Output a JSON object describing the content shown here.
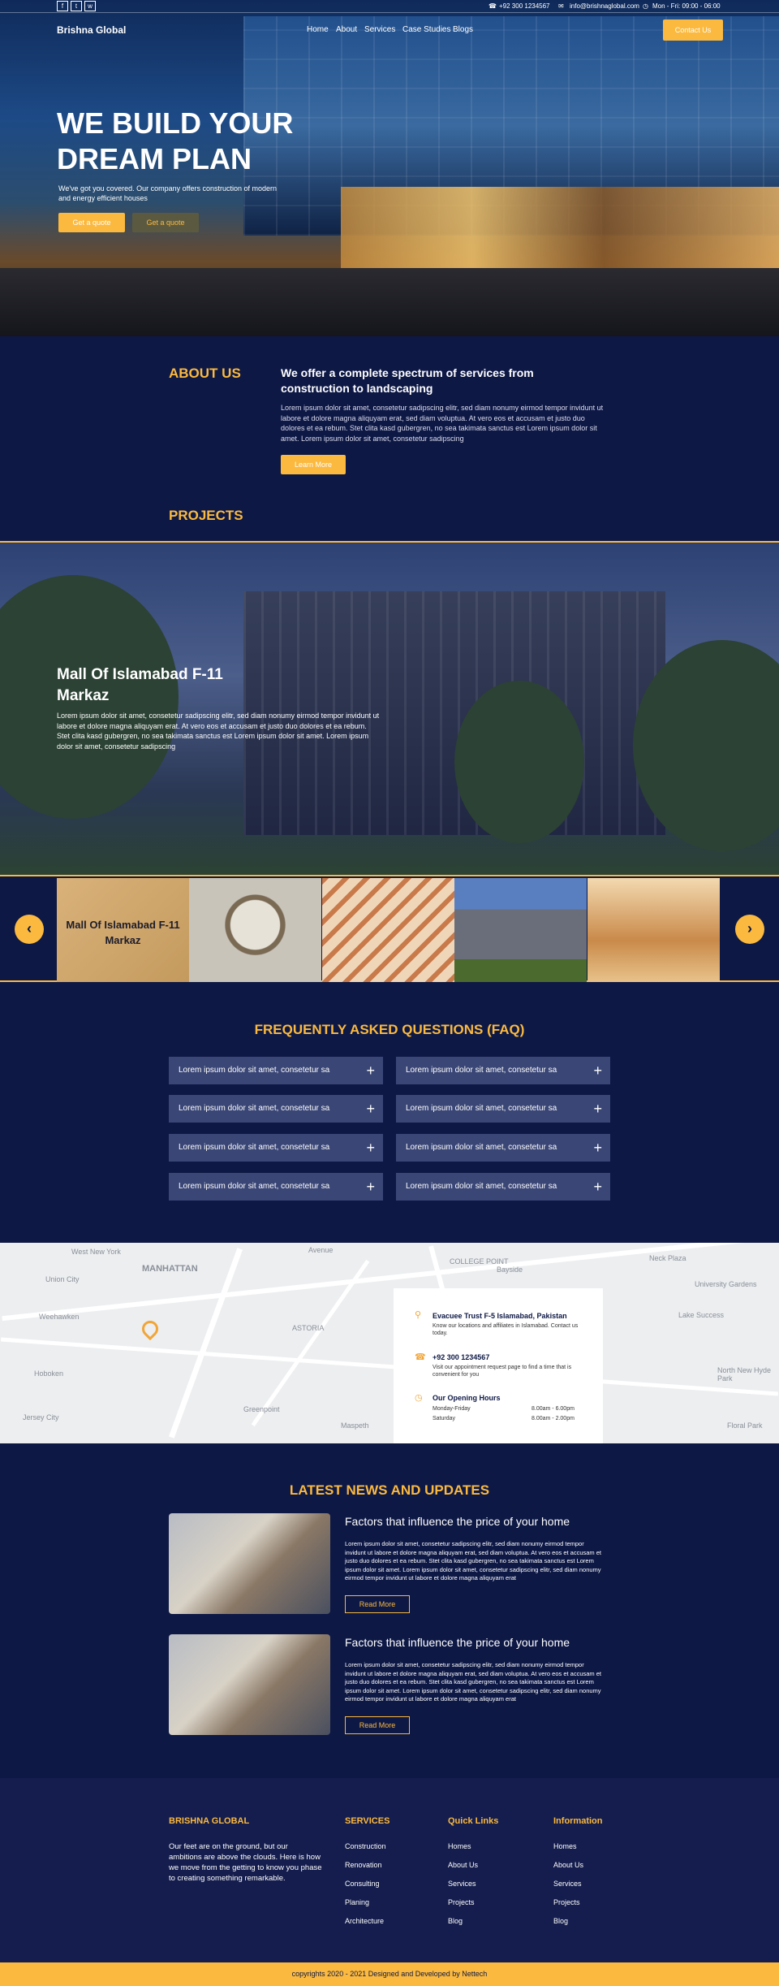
{
  "topbar": {
    "social": [
      "f",
      "t",
      "w"
    ],
    "phone": "+92 300 1234567",
    "email": "info@brishnaglobal.com",
    "hours": "Mon - Fri: 09:00 - 06:00"
  },
  "header": {
    "logo": "Brishna Global",
    "nav": [
      "Home",
      "About",
      "Services",
      "Case Studies",
      "Blogs"
    ],
    "contact_button": "Contact Us"
  },
  "hero": {
    "title": "WE BUILD YOUR DREAM PLAN",
    "subtitle": "We've got you covered. Our company offers construction of modern and energy efficient houses",
    "button_primary": "Get a quote",
    "button_secondary": "Get a quote"
  },
  "about": {
    "title": "ABOUT US",
    "heading": "We offer a complete spectrum of services from construction to landscaping",
    "text": "Lorem ipsum dolor sit amet, consetetur sadipscing elitr, sed diam nonumy eirmod tempor invidunt ut labore et dolore magna aliquyam erat, sed diam voluptua. At vero eos et accusam et justo duo dolores et ea rebum. Stet clita kasd gubergren, no sea takimata sanctus est Lorem ipsum dolor sit amet. Lorem ipsum dolor sit amet, consetetur sadipscing",
    "button": "Learn More"
  },
  "projects": {
    "title": "PROJECTS",
    "featured_title": "Mall Of Islamabad F-11 Markaz",
    "featured_text": "Lorem ipsum dolor sit amet, consetetur sadipscing elitr, sed diam nonumy eirmod tempor invidunt ut labore et dolore magna aliquyam erat. At vero eos et accusam et justo duo dolores et ea rebum. Stet clita kasd gubergren, no sea takimata sanctus est Lorem ipsum dolor sit amet. Lorem ipsum dolor sit amet, consetetur sadipscing",
    "thumb_label": "Mall Of Islamabad F-11 Markaz"
  },
  "faq": {
    "title": "FREQUENTLY ASKED QUESTIONS (FAQ)",
    "items": [
      "Lorem ipsum dolor sit amet, consetetur sa",
      "Lorem ipsum dolor sit amet, consetetur sa",
      "Lorem ipsum dolor sit amet, consetetur sa",
      "Lorem ipsum dolor sit amet, consetetur sa",
      "Lorem ipsum dolor sit amet, consetetur sa",
      "Lorem ipsum dolor sit amet, consetetur sa",
      "Lorem ipsum dolor sit amet, consetetur sa",
      "Lorem ipsum dolor sit amet, consetetur sa"
    ]
  },
  "map": {
    "labels": [
      "West New York",
      "MANHATTAN",
      "Union City",
      "Weehawken",
      "Hoboken",
      "Jersey City",
      "ASTORIA",
      "Maspeth",
      "Greenpoint",
      "Avenue",
      "Neck Plaza",
      "University Gardens",
      "Lake Success",
      "North New Hyde Park",
      "Floral Park",
      "Bayside",
      "COLLEGE POINT"
    ],
    "address_title": "Evacuee Trust F-5 Islamabad, Pakistan",
    "address_text": "Know our locations and affiliates in Islamabad. Contact us today.",
    "phone": "+92 300 1234567",
    "phone_text": "Visit our appointment request page to find a time that is convenient for you",
    "hours_title": "Our Opening Hours",
    "hours": [
      {
        "day": "Monday-Friday",
        "time": "8.00am - 6.00pm"
      },
      {
        "day": "Saturday",
        "time": "8.00am - 2.00pm"
      }
    ]
  },
  "news": {
    "title": "LATEST NEWS AND UPDATES",
    "items": [
      {
        "heading": "Factors that influence the price of your home",
        "text": "Lorem ipsum dolor sit amet, consetetur sadipscing elitr, sed diam nonumy eirmod tempor invidunt ut labore et dolore magna aliquyam erat, sed diam voluptua. At vero eos et accusam et justo duo dolores et ea rebum. Stet clita kasd gubergren, no sea takimata sanctus est Lorem ipsum dolor sit amet. Lorem ipsum dolor sit amet, consetetur sadipscing elitr, sed diam nonumy eirmod tempor invidunt ut labore et dolore magna aliquyam erat",
        "button": "Read More"
      },
      {
        "heading": "Factors that influence the price of your home",
        "text": "Lorem ipsum dolor sit amet, consetetur sadipscing elitr, sed diam nonumy eirmod tempor invidunt ut labore et dolore magna aliquyam erat, sed diam voluptua. At vero eos et accusam et justo duo dolores et ea rebum. Stet clita kasd gubergren, no sea takimata sanctus est Lorem ipsum dolor sit amet. Lorem ipsum dolor sit amet, consetetur sadipscing elitr, sed diam nonumy eirmod tempor invidunt ut labore et dolore magna aliquyam erat",
        "button": "Read More"
      }
    ]
  },
  "footer": {
    "brand": "BRISHNA GLOBAL",
    "description": "Our feet are on the ground, but our ambitions are above the clouds. Here is how we move from the getting to know you phase to creating something remarkable.",
    "services_title": "SERVICES",
    "services": [
      "Construction",
      "Renovation",
      "Consulting",
      "Planing",
      "Architecture"
    ],
    "quick_title": "Quick Links",
    "quick": [
      "Homes",
      "About Us",
      "Services",
      "Projects",
      "Blog"
    ],
    "info_title": "Information",
    "info": [
      "Homes",
      "About Us",
      "Services",
      "Projects",
      "Blog"
    ],
    "copyright": "copyrights 2020 - 2021 Designed and Developed by Nettech"
  }
}
